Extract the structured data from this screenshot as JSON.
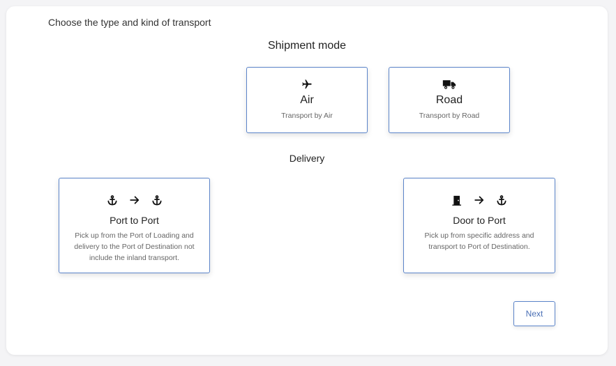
{
  "instruction": "Choose the type and kind of transport",
  "shipment": {
    "title": "Shipment mode",
    "options": [
      {
        "icon": "airplane-icon",
        "title": "Air",
        "subtitle": "Transport by Air"
      },
      {
        "icon": "truck-icon",
        "title": "Road",
        "subtitle": "Transport by Road"
      }
    ]
  },
  "delivery": {
    "title": "Delivery",
    "options": [
      {
        "icons": [
          "anchor-icon",
          "arrow-right-icon",
          "anchor-icon"
        ],
        "title": "Port to Port",
        "description": "Pick up from the Port of Loading and delivery to the Port of Destination not include the inland transport."
      },
      {
        "icons": [
          "door-icon",
          "arrow-right-icon",
          "anchor-icon"
        ],
        "title": "Door to Port",
        "description": "Pick up from specific address and transport to Port of Destination."
      }
    ]
  },
  "actions": {
    "next_label": "Next"
  },
  "colors": {
    "accent_border": "#5b84c9",
    "button_text": "#4a6fb5"
  }
}
